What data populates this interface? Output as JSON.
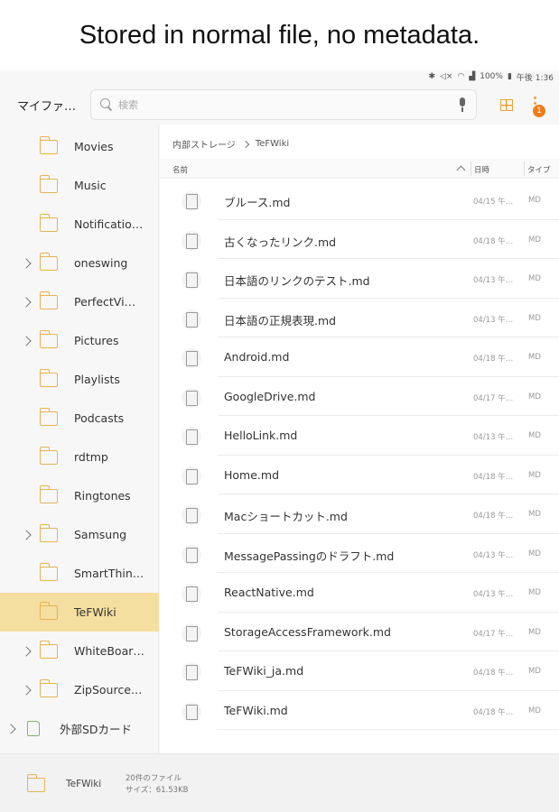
{
  "caption": "Stored in normal file, no metadata.",
  "status_bar": {
    "battery": "100%",
    "time": "午後 1:36"
  },
  "toolbar": {
    "title": "マイファ…",
    "search_placeholder": "検索",
    "badge_count": "1"
  },
  "sidebar": {
    "items": [
      {
        "label": "Movies",
        "expandable": false,
        "selected": false
      },
      {
        "label": "Music",
        "expandable": false,
        "selected": false
      },
      {
        "label": "Notificatio…",
        "expandable": false,
        "selected": false
      },
      {
        "label": "oneswing",
        "expandable": true,
        "selected": false
      },
      {
        "label": "PerfectVi…",
        "expandable": true,
        "selected": false
      },
      {
        "label": "Pictures",
        "expandable": true,
        "selected": false
      },
      {
        "label": "Playlists",
        "expandable": false,
        "selected": false
      },
      {
        "label": "Podcasts",
        "expandable": false,
        "selected": false
      },
      {
        "label": "rdtmp",
        "expandable": false,
        "selected": false
      },
      {
        "label": "Ringtones",
        "expandable": false,
        "selected": false
      },
      {
        "label": "Samsung",
        "expandable": true,
        "selected": false
      },
      {
        "label": "SmartThin…",
        "expandable": false,
        "selected": false
      },
      {
        "label": "TeFWiki",
        "expandable": false,
        "selected": true
      },
      {
        "label": "WhiteBoar…",
        "expandable": true,
        "selected": false
      },
      {
        "label": "ZipSource…",
        "expandable": true,
        "selected": false
      }
    ],
    "sd_card": "外部SDカード"
  },
  "breadcrumb": {
    "root": "内部ストレージ",
    "current": "TeFWiki"
  },
  "columns": {
    "name": "名前",
    "date": "日時",
    "type": "タイプ"
  },
  "files": [
    {
      "name": "ブルース.md",
      "date": "04/15 午…",
      "type": "MD"
    },
    {
      "name": "古くなったリンク.md",
      "date": "04/18 午…",
      "type": "MD"
    },
    {
      "name": "日本語のリンクのテスト.md",
      "date": "04/13 午…",
      "type": "MD"
    },
    {
      "name": "日本語の正規表現.md",
      "date": "04/13 午…",
      "type": "MD"
    },
    {
      "name": "Android.md",
      "date": "04/18 午…",
      "type": "MD"
    },
    {
      "name": "GoogleDrive.md",
      "date": "04/17 午…",
      "type": "MD"
    },
    {
      "name": "HelloLink.md",
      "date": "04/13 午…",
      "type": "MD"
    },
    {
      "name": "Home.md",
      "date": "04/18 午…",
      "type": "MD"
    },
    {
      "name": "Macショートカット.md",
      "date": "04/18 午…",
      "type": "MD"
    },
    {
      "name": "MessagePassingのドラフト.md",
      "date": "04/13 午…",
      "type": "MD"
    },
    {
      "name": "ReactNative.md",
      "date": "04/13 午…",
      "type": "MD"
    },
    {
      "name": "StorageAccessFramework.md",
      "date": "04/17 午…",
      "type": "MD"
    },
    {
      "name": "TeFWiki_ja.md",
      "date": "04/18 午…",
      "type": "MD"
    },
    {
      "name": "TeFWiki.md",
      "date": "04/18 午…",
      "type": "MD"
    }
  ],
  "footer": {
    "folder_name": "TeFWiki",
    "file_count": "20件のファイル",
    "size": "サイズ：61.53KB"
  },
  "colors": {
    "accent": "#e8a53a",
    "selected_bg": "#f5dfa0",
    "badge": "#ef7d1a"
  },
  "icons": [
    "bluetooth-icon",
    "mute-icon",
    "wifi-icon",
    "signal-icon",
    "battery-icon",
    "search-icon",
    "mic-icon",
    "grid-view-icon",
    "more-options-icon",
    "folder-icon",
    "file-icon",
    "sd-card-icon",
    "chevron-right-icon",
    "sort-up-icon"
  ]
}
